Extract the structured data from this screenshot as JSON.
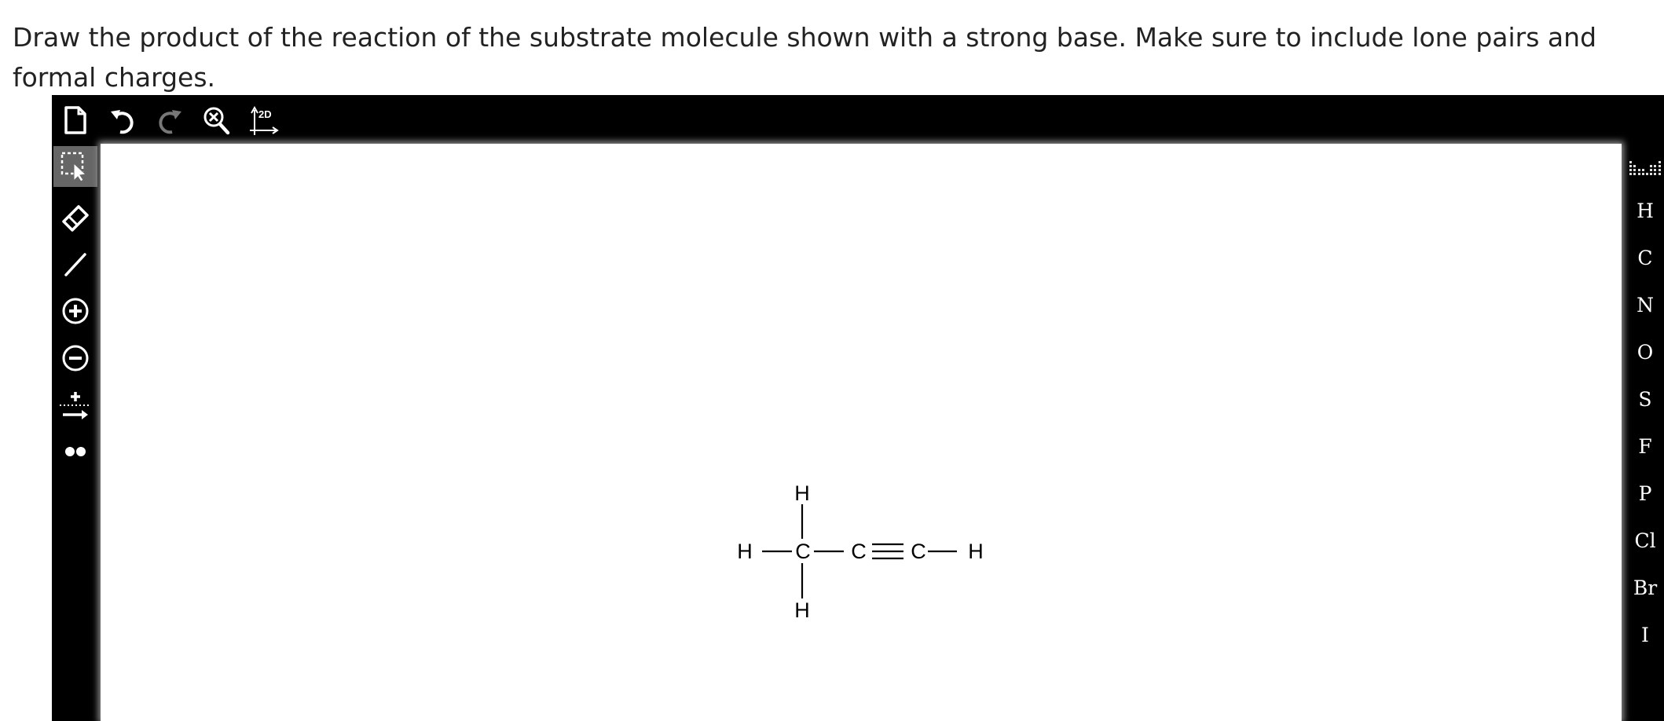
{
  "question": {
    "text": "Draw the product of the reaction of the substrate molecule shown with a strong base. Make sure to include lone pairs and formal charges."
  },
  "top_toolbar": {
    "items": [
      {
        "name": "new-document",
        "icon": "document-icon"
      },
      {
        "name": "undo",
        "icon": "undo-icon"
      },
      {
        "name": "redo",
        "icon": "redo-icon"
      },
      {
        "name": "zoom-clear",
        "icon": "zoom-x-icon"
      },
      {
        "name": "clean-2d",
        "icon": "2d-axes-icon",
        "label": "2D"
      }
    ]
  },
  "left_toolbar": {
    "items": [
      {
        "name": "select",
        "icon": "selection-arrow-icon",
        "active": true
      },
      {
        "name": "erase",
        "icon": "eraser-icon"
      },
      {
        "name": "bond",
        "icon": "bond-line-icon"
      },
      {
        "name": "positive-charge",
        "icon": "plus-circle-icon"
      },
      {
        "name": "negative-charge",
        "icon": "minus-circle-icon"
      },
      {
        "name": "reaction-arrow",
        "icon": "plus-arrow-icon"
      },
      {
        "name": "lone-pair",
        "icon": "lone-pair-icon"
      }
    ]
  },
  "element_palette": {
    "elements": [
      "H",
      "C",
      "N",
      "O",
      "S",
      "F",
      "P",
      "Cl",
      "Br",
      "I"
    ],
    "periodic_table_icon": "periodic-table-icon"
  },
  "molecule": {
    "atoms": {
      "h_top": "H",
      "h_left": "H",
      "c1": "C",
      "c2": "C",
      "c3": "C",
      "h_right": "H",
      "h_bottom": "H"
    }
  }
}
